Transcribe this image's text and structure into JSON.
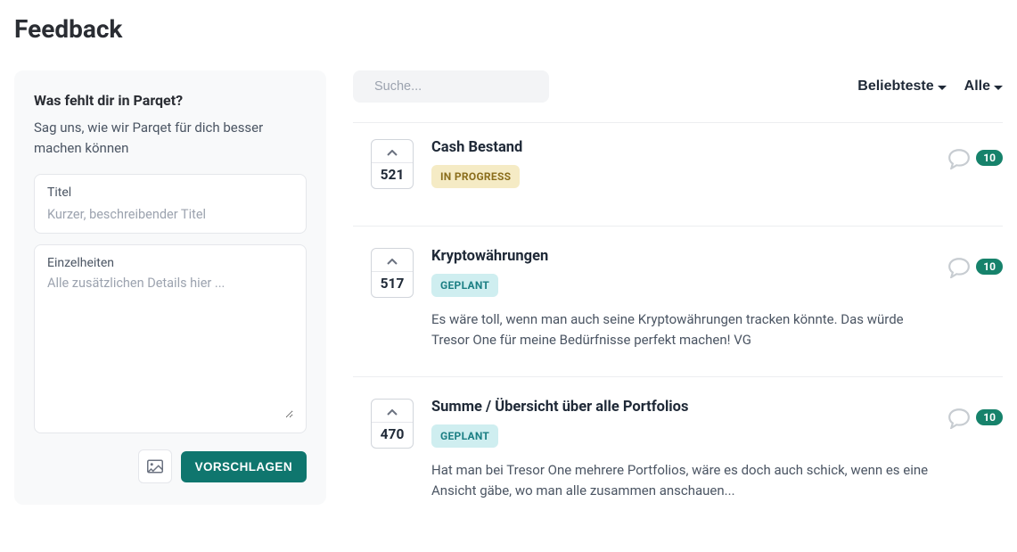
{
  "page": {
    "title": "Feedback"
  },
  "sidebar": {
    "heading": "Was fehlt dir in Parqet?",
    "subheading": "Sag uns, wie wir Parqet für dich besser machen können",
    "title_field_label": "Titel",
    "title_field_placeholder": "Kurzer, beschreibender Titel",
    "details_field_label": "Einzelheiten",
    "details_field_placeholder": "Alle zusätzlichen Details hier ...",
    "submit_label": "VORSCHLAGEN"
  },
  "toolbar": {
    "search_placeholder": "Suche...",
    "sort_label": "Beliebteste",
    "filter_label": "Alle"
  },
  "items": [
    {
      "votes": "521",
      "title": "Cash Bestand",
      "status_label": "IN PROGRESS",
      "status_kind": "inprogress",
      "description": "",
      "comments": "10"
    },
    {
      "votes": "517",
      "title": "Kryptowährungen",
      "status_label": "GEPLANT",
      "status_kind": "planned",
      "description": "Es wäre toll, wenn man auch seine Kryptowährungen tracken könnte. Das würde Tresor One für meine Bedürfnisse perfekt machen! VG",
      "comments": "10"
    },
    {
      "votes": "470",
      "title": "Summe / Übersicht über alle Portfolios",
      "status_label": "GEPLANT",
      "status_kind": "planned",
      "description": "Hat man bei Tresor One mehrere Portfolios, wäre es doch auch schick, wenn es eine Ansicht gäbe, wo man alle zusammen anschauen...",
      "comments": "10"
    }
  ]
}
